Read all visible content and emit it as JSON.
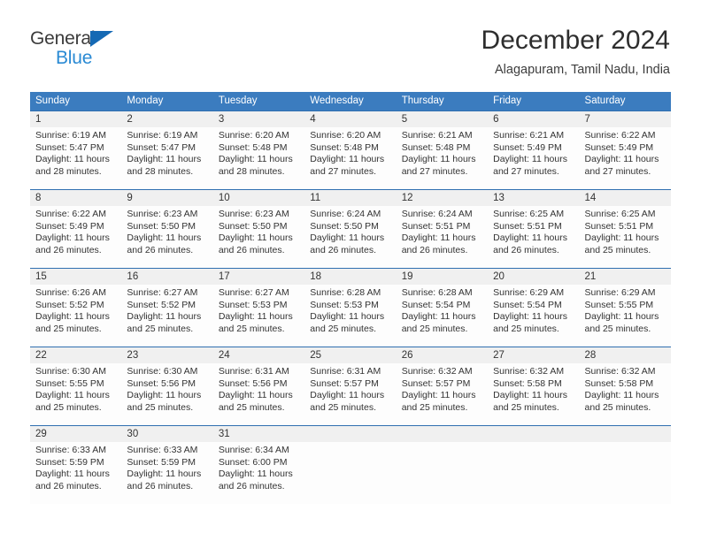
{
  "brand": {
    "name_part1": "General",
    "name_part2": "Blue",
    "triangle_color": "#1569b4",
    "blue_text_color": "#2a8ad4"
  },
  "header": {
    "title": "December 2024",
    "subtitle": "Alagapuram, Tamil Nadu, India"
  },
  "theme": {
    "header_bar_color": "#3b7cbf",
    "week_divider_color": "#2f6fb0",
    "day_number_band_color": "#f0f0f0",
    "text_color": "#333333"
  },
  "weekdays": [
    "Sunday",
    "Monday",
    "Tuesday",
    "Wednesday",
    "Thursday",
    "Friday",
    "Saturday"
  ],
  "weeks": [
    {
      "days": [
        {
          "num": "1",
          "sunrise": "Sunrise: 6:19 AM",
          "sunset": "Sunset: 5:47 PM",
          "daylight1": "Daylight: 11 hours",
          "daylight2": "and 28 minutes."
        },
        {
          "num": "2",
          "sunrise": "Sunrise: 6:19 AM",
          "sunset": "Sunset: 5:47 PM",
          "daylight1": "Daylight: 11 hours",
          "daylight2": "and 28 minutes."
        },
        {
          "num": "3",
          "sunrise": "Sunrise: 6:20 AM",
          "sunset": "Sunset: 5:48 PM",
          "daylight1": "Daylight: 11 hours",
          "daylight2": "and 28 minutes."
        },
        {
          "num": "4",
          "sunrise": "Sunrise: 6:20 AM",
          "sunset": "Sunset: 5:48 PM",
          "daylight1": "Daylight: 11 hours",
          "daylight2": "and 27 minutes."
        },
        {
          "num": "5",
          "sunrise": "Sunrise: 6:21 AM",
          "sunset": "Sunset: 5:48 PM",
          "daylight1": "Daylight: 11 hours",
          "daylight2": "and 27 minutes."
        },
        {
          "num": "6",
          "sunrise": "Sunrise: 6:21 AM",
          "sunset": "Sunset: 5:49 PM",
          "daylight1": "Daylight: 11 hours",
          "daylight2": "and 27 minutes."
        },
        {
          "num": "7",
          "sunrise": "Sunrise: 6:22 AM",
          "sunset": "Sunset: 5:49 PM",
          "daylight1": "Daylight: 11 hours",
          "daylight2": "and 27 minutes."
        }
      ]
    },
    {
      "days": [
        {
          "num": "8",
          "sunrise": "Sunrise: 6:22 AM",
          "sunset": "Sunset: 5:49 PM",
          "daylight1": "Daylight: 11 hours",
          "daylight2": "and 26 minutes."
        },
        {
          "num": "9",
          "sunrise": "Sunrise: 6:23 AM",
          "sunset": "Sunset: 5:50 PM",
          "daylight1": "Daylight: 11 hours",
          "daylight2": "and 26 minutes."
        },
        {
          "num": "10",
          "sunrise": "Sunrise: 6:23 AM",
          "sunset": "Sunset: 5:50 PM",
          "daylight1": "Daylight: 11 hours",
          "daylight2": "and 26 minutes."
        },
        {
          "num": "11",
          "sunrise": "Sunrise: 6:24 AM",
          "sunset": "Sunset: 5:50 PM",
          "daylight1": "Daylight: 11 hours",
          "daylight2": "and 26 minutes."
        },
        {
          "num": "12",
          "sunrise": "Sunrise: 6:24 AM",
          "sunset": "Sunset: 5:51 PM",
          "daylight1": "Daylight: 11 hours",
          "daylight2": "and 26 minutes."
        },
        {
          "num": "13",
          "sunrise": "Sunrise: 6:25 AM",
          "sunset": "Sunset: 5:51 PM",
          "daylight1": "Daylight: 11 hours",
          "daylight2": "and 26 minutes."
        },
        {
          "num": "14",
          "sunrise": "Sunrise: 6:25 AM",
          "sunset": "Sunset: 5:51 PM",
          "daylight1": "Daylight: 11 hours",
          "daylight2": "and 25 minutes."
        }
      ]
    },
    {
      "days": [
        {
          "num": "15",
          "sunrise": "Sunrise: 6:26 AM",
          "sunset": "Sunset: 5:52 PM",
          "daylight1": "Daylight: 11 hours",
          "daylight2": "and 25 minutes."
        },
        {
          "num": "16",
          "sunrise": "Sunrise: 6:27 AM",
          "sunset": "Sunset: 5:52 PM",
          "daylight1": "Daylight: 11 hours",
          "daylight2": "and 25 minutes."
        },
        {
          "num": "17",
          "sunrise": "Sunrise: 6:27 AM",
          "sunset": "Sunset: 5:53 PM",
          "daylight1": "Daylight: 11 hours",
          "daylight2": "and 25 minutes."
        },
        {
          "num": "18",
          "sunrise": "Sunrise: 6:28 AM",
          "sunset": "Sunset: 5:53 PM",
          "daylight1": "Daylight: 11 hours",
          "daylight2": "and 25 minutes."
        },
        {
          "num": "19",
          "sunrise": "Sunrise: 6:28 AM",
          "sunset": "Sunset: 5:54 PM",
          "daylight1": "Daylight: 11 hours",
          "daylight2": "and 25 minutes."
        },
        {
          "num": "20",
          "sunrise": "Sunrise: 6:29 AM",
          "sunset": "Sunset: 5:54 PM",
          "daylight1": "Daylight: 11 hours",
          "daylight2": "and 25 minutes."
        },
        {
          "num": "21",
          "sunrise": "Sunrise: 6:29 AM",
          "sunset": "Sunset: 5:55 PM",
          "daylight1": "Daylight: 11 hours",
          "daylight2": "and 25 minutes."
        }
      ]
    },
    {
      "days": [
        {
          "num": "22",
          "sunrise": "Sunrise: 6:30 AM",
          "sunset": "Sunset: 5:55 PM",
          "daylight1": "Daylight: 11 hours",
          "daylight2": "and 25 minutes."
        },
        {
          "num": "23",
          "sunrise": "Sunrise: 6:30 AM",
          "sunset": "Sunset: 5:56 PM",
          "daylight1": "Daylight: 11 hours",
          "daylight2": "and 25 minutes."
        },
        {
          "num": "24",
          "sunrise": "Sunrise: 6:31 AM",
          "sunset": "Sunset: 5:56 PM",
          "daylight1": "Daylight: 11 hours",
          "daylight2": "and 25 minutes."
        },
        {
          "num": "25",
          "sunrise": "Sunrise: 6:31 AM",
          "sunset": "Sunset: 5:57 PM",
          "daylight1": "Daylight: 11 hours",
          "daylight2": "and 25 minutes."
        },
        {
          "num": "26",
          "sunrise": "Sunrise: 6:32 AM",
          "sunset": "Sunset: 5:57 PM",
          "daylight1": "Daylight: 11 hours",
          "daylight2": "and 25 minutes."
        },
        {
          "num": "27",
          "sunrise": "Sunrise: 6:32 AM",
          "sunset": "Sunset: 5:58 PM",
          "daylight1": "Daylight: 11 hours",
          "daylight2": "and 25 minutes."
        },
        {
          "num": "28",
          "sunrise": "Sunrise: 6:32 AM",
          "sunset": "Sunset: 5:58 PM",
          "daylight1": "Daylight: 11 hours",
          "daylight2": "and 25 minutes."
        }
      ]
    },
    {
      "days": [
        {
          "num": "29",
          "sunrise": "Sunrise: 6:33 AM",
          "sunset": "Sunset: 5:59 PM",
          "daylight1": "Daylight: 11 hours",
          "daylight2": "and 26 minutes."
        },
        {
          "num": "30",
          "sunrise": "Sunrise: 6:33 AM",
          "sunset": "Sunset: 5:59 PM",
          "daylight1": "Daylight: 11 hours",
          "daylight2": "and 26 minutes."
        },
        {
          "num": "31",
          "sunrise": "Sunrise: 6:34 AM",
          "sunset": "Sunset: 6:00 PM",
          "daylight1": "Daylight: 11 hours",
          "daylight2": "and 26 minutes."
        },
        {
          "num": "",
          "sunrise": "",
          "sunset": "",
          "daylight1": "",
          "daylight2": ""
        },
        {
          "num": "",
          "sunrise": "",
          "sunset": "",
          "daylight1": "",
          "daylight2": ""
        },
        {
          "num": "",
          "sunrise": "",
          "sunset": "",
          "daylight1": "",
          "daylight2": ""
        },
        {
          "num": "",
          "sunrise": "",
          "sunset": "",
          "daylight1": "",
          "daylight2": ""
        }
      ]
    }
  ]
}
